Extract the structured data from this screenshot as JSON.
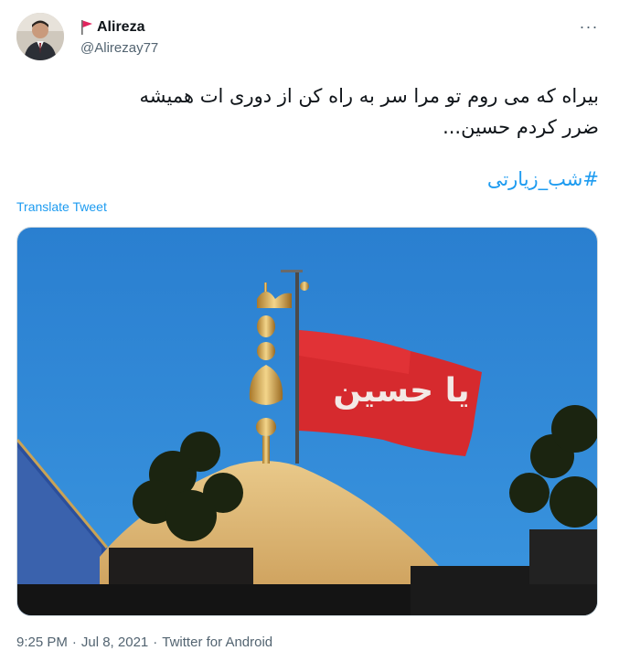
{
  "author": {
    "display_name": "Alireza",
    "handle": "@Alirezay77",
    "flag_icon": "red-flag-icon"
  },
  "menu": {
    "icon": "more-horizontal-icon",
    "label": "···"
  },
  "tweet": {
    "line1": "بیراه که می روم تو مرا سر به راه کن از دوری ات همیشه",
    "line2": "ضرر کردم حسین...",
    "hashtag": "#شب_زیارتی",
    "translate_label": "Translate Tweet"
  },
  "media": {
    "description_icon": "shrine-flag-photo",
    "flag_text": "یا حسین"
  },
  "meta": {
    "time": "9:25 PM",
    "sep1": "·",
    "date": "Jul 8, 2021",
    "sep2": "·",
    "source": "Twitter for Android"
  },
  "colors": {
    "accent": "#1d9bf0",
    "secondary_text": "#536471",
    "flag_red": "#d62a2e",
    "sky": "#2f86d4"
  }
}
